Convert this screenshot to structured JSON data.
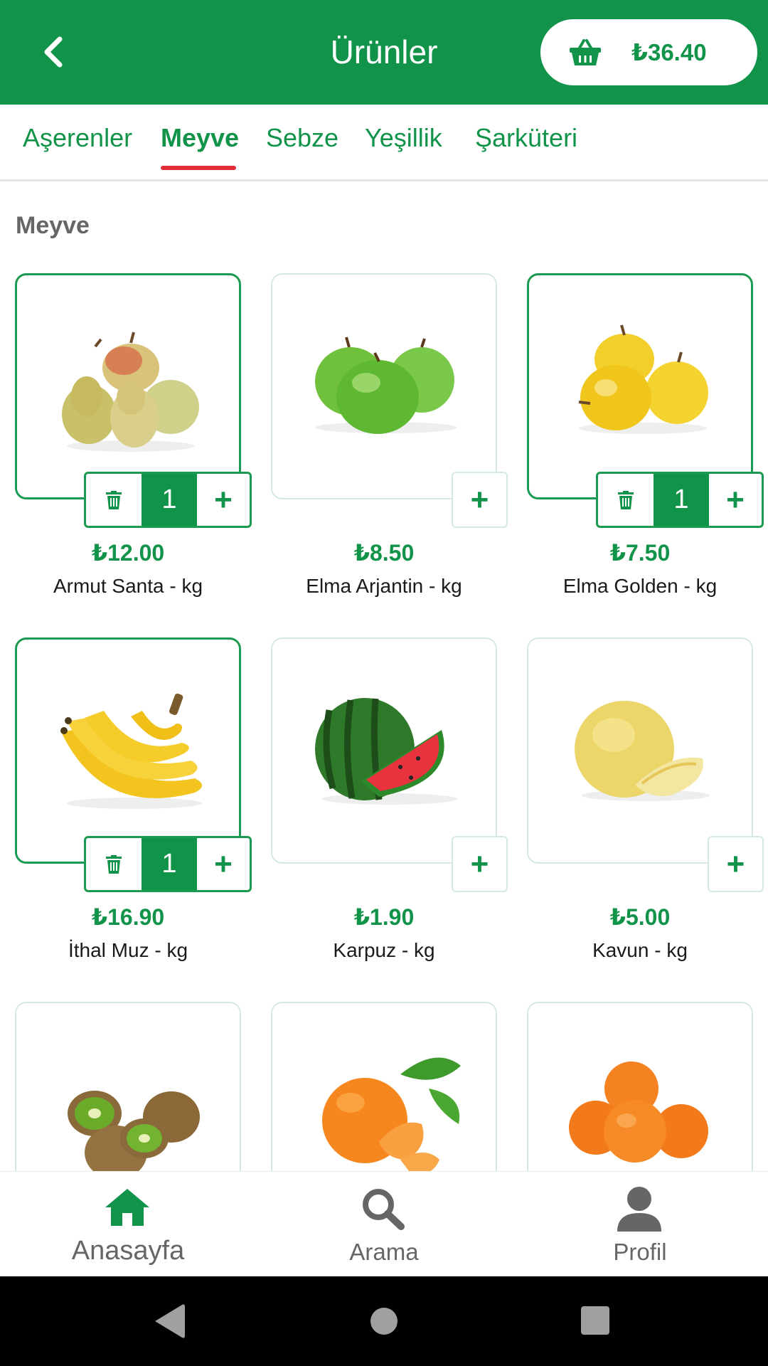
{
  "header": {
    "title": "Ürünler",
    "back_icon": "chevron-left-icon",
    "cart_icon": "basket-icon",
    "cart_total": "₺36.40"
  },
  "tabs": [
    {
      "label": "Aşerenler",
      "active": false
    },
    {
      "label": "Meyve",
      "active": true
    },
    {
      "label": "Sebze",
      "active": false
    },
    {
      "label": "Yeşillik",
      "active": false
    },
    {
      "label": "Şarküteri",
      "active": false
    }
  ],
  "section_title": "Meyve",
  "products": [
    {
      "name": "Armut Santa - kg",
      "price": "₺12.00",
      "quantity": "1",
      "in_cart": true,
      "image": "pears"
    },
    {
      "name": "Elma Arjantin - kg",
      "price": "₺8.50",
      "in_cart": false,
      "image": "green-apples"
    },
    {
      "name": "Elma Golden - kg",
      "price": "₺7.50",
      "quantity": "1",
      "in_cart": true,
      "image": "golden-apples"
    },
    {
      "name": "İthal Muz - kg",
      "price": "₺16.90",
      "quantity": "1",
      "in_cart": true,
      "image": "bananas"
    },
    {
      "name": "Karpuz - kg",
      "price": "₺1.90",
      "in_cart": false,
      "image": "watermelon"
    },
    {
      "name": "Kavun - kg",
      "price": "₺5.00",
      "in_cart": false,
      "image": "melon"
    },
    {
      "image": "kiwis"
    },
    {
      "image": "tangerines"
    },
    {
      "image": "oranges"
    }
  ],
  "bottom_nav": [
    {
      "label": "Anasayfa",
      "icon": "home-icon",
      "active": true
    },
    {
      "label": "Arama",
      "icon": "search-icon",
      "active": false
    },
    {
      "label": "Profil",
      "icon": "user-icon",
      "active": false
    }
  ],
  "system_nav": [
    "back-icon",
    "home-circle-icon",
    "recents-icon"
  ],
  "colors": {
    "primary": "#12934a",
    "tab_indicator": "#e02f36",
    "card_border": "#d5ebe0",
    "muted_text": "#666666"
  }
}
